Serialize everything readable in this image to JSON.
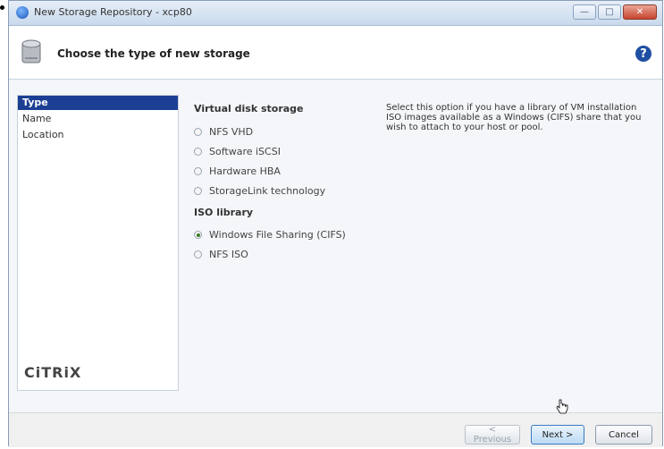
{
  "window": {
    "title": "New Storage Repository - xcp80"
  },
  "header": {
    "title": "Choose the type of new storage",
    "help_glyph": "?"
  },
  "sidebar": {
    "items": [
      {
        "label": "Type",
        "active": true
      },
      {
        "label": "Name",
        "active": false
      },
      {
        "label": "Location",
        "active": false
      }
    ],
    "brand": "CiTRiX"
  },
  "content": {
    "virtual_disk": {
      "heading": "Virtual disk storage",
      "options": [
        {
          "label": "NFS VHD",
          "checked": false
        },
        {
          "label": "Software iSCSI",
          "checked": false
        },
        {
          "label": "Hardware HBA",
          "checked": false
        },
        {
          "label": "StorageLink technology",
          "checked": false
        }
      ]
    },
    "iso_library": {
      "heading": "ISO library",
      "options": [
        {
          "label": "Windows File Sharing (CIFS)",
          "checked": true
        },
        {
          "label": "NFS ISO",
          "checked": false
        }
      ]
    },
    "description": "Select this option if you have a library of VM installation ISO images available as a Windows (CIFS) share that you wish to attach to your host or pool."
  },
  "footer": {
    "previous_label": "< Previous",
    "next_label": "Next >",
    "cancel_label": "Cancel"
  }
}
